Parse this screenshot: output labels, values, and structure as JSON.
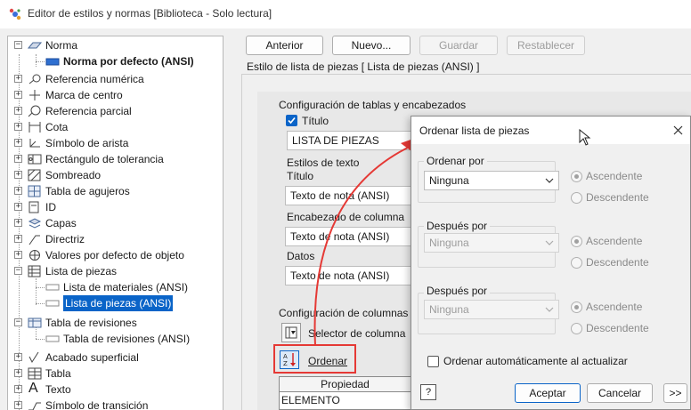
{
  "window": {
    "title": "Editor de estilos y normas [Biblioteca - Solo lectura]"
  },
  "tree": {
    "items": [
      {
        "label": "Norma",
        "icon": "standard-icon"
      },
      {
        "label": "Norma por defecto (ANSI)",
        "icon": "standard-item-icon"
      },
      {
        "label": "Referencia numérica",
        "icon": "balloon-icon"
      },
      {
        "label": "Marca de centro",
        "icon": "center-mark-icon"
      },
      {
        "label": "Referencia parcial",
        "icon": "detail-view-icon"
      },
      {
        "label": "Cota",
        "icon": "dimension-icon"
      },
      {
        "label": "Símbolo de arista",
        "icon": "edge-symbol-icon"
      },
      {
        "label": "Rectángulo de tolerancia",
        "icon": "feature-control-frame-icon"
      },
      {
        "label": "Sombreado",
        "icon": "hatch-icon"
      },
      {
        "label": "Tabla de agujeros",
        "icon": "hole-table-icon"
      },
      {
        "label": "ID",
        "icon": "id-icon"
      },
      {
        "label": "Capas",
        "icon": "layers-icon"
      },
      {
        "label": "Directriz",
        "icon": "leader-icon"
      },
      {
        "label": "Valores por defecto de objeto",
        "icon": "object-defaults-icon"
      },
      {
        "label": "Lista de piezas",
        "icon": "parts-list-icon"
      },
      {
        "label": "Lista de materiales (ANSI)",
        "icon": "style-item-icon"
      },
      {
        "label": "Lista de piezas (ANSI)",
        "icon": "style-item-icon"
      },
      {
        "label": "Tabla de revisiones",
        "icon": "revision-table-icon"
      },
      {
        "label": "Tabla de revisiones (ANSI)",
        "icon": "style-item-icon"
      },
      {
        "label": "Acabado superficial",
        "icon": "surface-texture-icon"
      },
      {
        "label": "Tabla",
        "icon": "table-icon"
      },
      {
        "label": "Texto",
        "icon": "text-icon"
      },
      {
        "label": "Símbolo de transición",
        "icon": "weld-symbol-icon"
      }
    ]
  },
  "toolbar": {
    "back": "Anterior",
    "new": "Nuevo...",
    "save": "Guardar",
    "reset": "Restablecer"
  },
  "panel": {
    "header": "Estilo de lista de piezas [ Lista de piezas (ANSI) ]",
    "table_config_label": "Configuración de tablas y encabezados",
    "title_check_label": "Título",
    "title_value": "LISTA DE PIEZAS",
    "text_styles_label": "Estilos de texto",
    "title_label": "Título",
    "title_style": "Texto de nota (ANSI)",
    "col_header_label": "Encabezado de columna",
    "col_header_style": "Texto de nota (ANSI)",
    "data_label": "Datos",
    "data_style": "Texto de nota (ANSI)",
    "col_config_label": "Configuración de columnas",
    "col_selector_label": "Selector de columna",
    "sort_label": "Ordenar",
    "table_header_property": "Propiedad",
    "table_first_row": "ELEMENTO"
  },
  "dialog": {
    "title": "Ordenar lista de piezas",
    "sort_by_label": "Ordenar por",
    "sort_by_value": "Ninguna",
    "then_by_label_1": "Después por",
    "then_by_value_1": "Ninguna",
    "then_by_label_2": "Después por",
    "then_by_value_2": "Ninguna",
    "ascending": "Ascendente",
    "descending": "Descendente",
    "auto_sort_label": "Ordenar automáticamente al actualizar",
    "ok": "Aceptar",
    "cancel": "Cancelar",
    "more": ">>",
    "help": "?"
  },
  "colors": {
    "selection": "#0a64c8",
    "highlight": "#e53935",
    "accent": "#0a64c8"
  }
}
